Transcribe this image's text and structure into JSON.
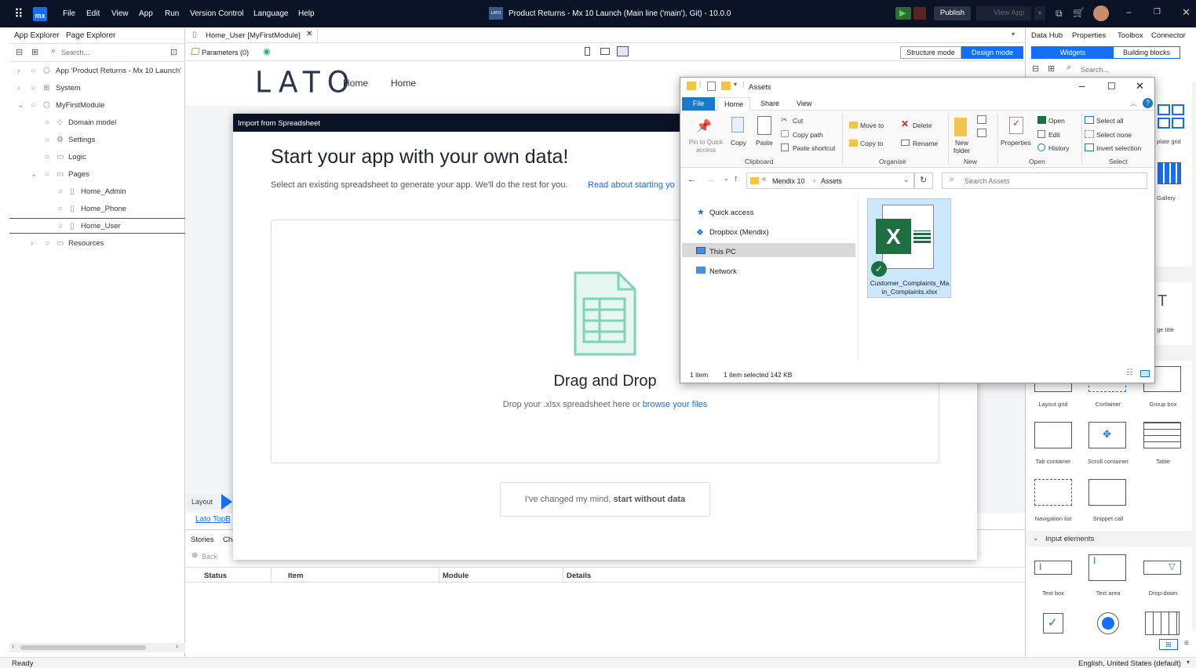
{
  "titlebar": {
    "menu": [
      "File",
      "Edit",
      "View",
      "App",
      "Run",
      "Version Control",
      "Language",
      "Help"
    ],
    "logo": "mx",
    "app_badge": "LATO",
    "title": "Product Returns - Mx 10 Launch (Main line ('main'), Git)  -  10.0.0",
    "publish": "Publish",
    "view_app": "View App"
  },
  "left": {
    "tabs": [
      "App Explorer",
      "Page Explorer"
    ],
    "search_placeholder": "Search...",
    "tree": [
      "App 'Product Returns - Mx 10 Launch'",
      "System",
      "MyFirstModule",
      "Domain model",
      "Settings",
      "Logic",
      "Pages",
      "Home_Admin",
      "Home_Phone",
      "Home_User",
      "Resources"
    ]
  },
  "doc": {
    "tab": "Home_User [MyFirstModule]",
    "parameters": "Parameters (0)",
    "structure_mode": "Structure mode",
    "design_mode": "Design mode",
    "canvas_logo": "LATO",
    "nav": [
      "Home",
      "Home"
    ],
    "layout_label": "Layout",
    "layout_link": "Lato TopB"
  },
  "bottom": {
    "tabs": [
      "Stories",
      "Cha"
    ],
    "back": "Back",
    "columns": [
      "Status",
      "Item",
      "Module",
      "Details"
    ]
  },
  "dialog": {
    "title": "Import from Spreadsheet",
    "heading": "Start your app with your own data!",
    "subtitle": "Select an existing spreadsheet to generate your app. We'll do the rest for you.",
    "subtitle_link": "Read about starting yo",
    "drop_title": "Drag and Drop",
    "drop_text": "Drop your .xlsx spreadsheet here or",
    "drop_link": "browse your files",
    "skip_prefix": "I've changed my mind,",
    "skip_bold": "start without data"
  },
  "right": {
    "tabs": [
      "Data Hub",
      "Properties",
      "Toolbox",
      "Connector"
    ],
    "sub_tabs": [
      "Widgets",
      "Building blocks"
    ],
    "search_placeholder": "Search...",
    "partial_labels": [
      "plate grid",
      "Gallery",
      "ge title"
    ],
    "widgets_row1": [
      "Layout grid",
      "Container",
      "Group box"
    ],
    "widgets_row2": [
      "Tab container",
      "Scroll container",
      "Table"
    ],
    "widgets_row3": [
      "Navigation list",
      "Snippet call"
    ],
    "section": "Input elements",
    "inputs": [
      "Text box",
      "Text area",
      "Drop-down"
    ]
  },
  "explorer": {
    "title": "Assets",
    "ribbon_tabs": [
      "File",
      "Home",
      "Share",
      "View"
    ],
    "clipboard": {
      "pin": "Pin to Quick access",
      "copy": "Copy",
      "paste": "Paste",
      "cut": "Cut",
      "copy_path": "Copy path",
      "paste_shortcut": "Paste shortcut",
      "group": "Clipboard"
    },
    "organise": {
      "move_to": "Move to",
      "copy_to": "Copy to",
      "delete": "Delete",
      "rename": "Rename",
      "group": "Organise"
    },
    "new": {
      "new_folder": "New folder",
      "group": "New"
    },
    "open": {
      "properties": "Properties",
      "open": "Open",
      "edit": "Edit",
      "history": "History",
      "group": "Open"
    },
    "select": {
      "select_all": "Select all",
      "select_none": "Select none",
      "invert": "Invert selection",
      "group": "Select"
    },
    "path": [
      "Mendix 10",
      "Assets"
    ],
    "search_placeholder": "Search Assets",
    "nav_items": [
      "Quick access",
      "Dropbox (Mendix)",
      "This PC",
      "Network"
    ],
    "file_name": "Customer_Complaints_Main_Complaints.xlsx",
    "status_items": "1 item",
    "status_selected": "1 item selected  142 KB"
  },
  "statusbar": {
    "left": "Ready",
    "right": "English, United States (default)"
  },
  "colors": {
    "mendix_blue": "#146ff8",
    "titlebar": "#0a1325",
    "excel_green": "#1d6f42"
  }
}
